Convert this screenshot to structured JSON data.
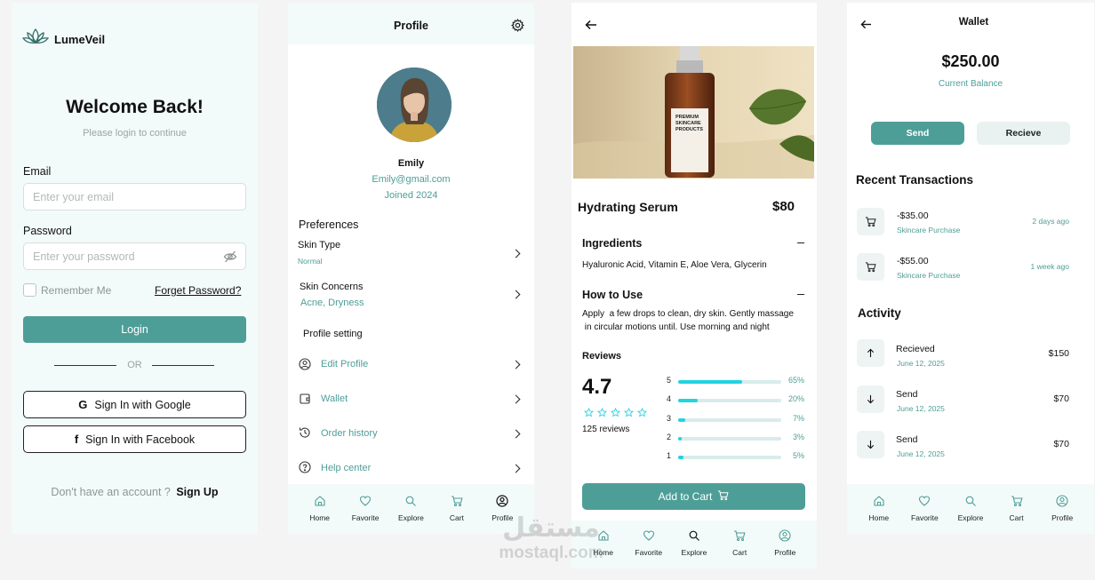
{
  "login": {
    "brand": "LumeVeil",
    "title": "Welcome Back!",
    "subtitle": "Please login to continue",
    "email_label": "Email",
    "email_placeholder": "Enter your email",
    "password_label": "Password",
    "password_placeholder": "Enter your password",
    "remember": "Remember Me",
    "forgot": "Forget Password?",
    "login_button": "Login",
    "or": "OR",
    "google": "Sign In with Google",
    "facebook": "Sign In with Facebook",
    "no_account": "Don't have an account ?",
    "signup": "Sign Up"
  },
  "profile": {
    "header": "Profile",
    "name": "Emily",
    "email": "Emily@gmail.com",
    "joined": "Joined 2024",
    "preferences": "Preferences",
    "skin_type_label": "Skin Type",
    "skin_type_value": "Normal",
    "skin_concerns_label": "Skin Concerns",
    "skin_concerns_value": "Acne, Dryness",
    "profile_setting": "Profile setting",
    "menu": [
      "Edit Profile",
      "Wallet",
      "Order history",
      "Help center"
    ]
  },
  "product": {
    "name": "Hydrating Serum",
    "price": "$80",
    "bottle_label": [
      "PREMIUM",
      "SKINCARE",
      "PRODUCTS"
    ],
    "ingredients_title": "Ingredients",
    "ingredients": "Hyaluronic Acid, Vitamin E, Aloe Vera, Glycerin",
    "how_title": "How to Use",
    "how_line1": "Apply  a few drops to clean, dry skin. Gently massage",
    "how_line2": " in circular motions until. Use morning and night",
    "reviews_title": "Reviews",
    "rating": "4.7",
    "review_count": "125 reviews",
    "rating_bars": [
      {
        "star": "5",
        "pct_label": "65%",
        "pct": 0.65
      },
      {
        "star": "4",
        "pct_label": "20%",
        "pct": 0.2
      },
      {
        "star": "3",
        "pct_label": "7%",
        "pct": 0.07
      },
      {
        "star": "2",
        "pct_label": "3%",
        "pct": 0.03
      },
      {
        "star": "1",
        "pct_label": "5%",
        "pct": 0.05
      }
    ],
    "add_to_cart": "Add to Cart"
  },
  "wallet": {
    "header": "Wallet",
    "balance": "$250.00",
    "balance_label": "Current Balance",
    "send": "Send",
    "receive": "Recieve",
    "recent_title": "Recent Transactions",
    "transactions": [
      {
        "amount": "-$35.00",
        "desc": "Skincare Purchase",
        "time": "2 days ago"
      },
      {
        "amount": "-$55.00",
        "desc": "Skincare Purchase",
        "time": "1 week ago"
      }
    ],
    "activity_title": "Activity",
    "activity": [
      {
        "type": "Recieved",
        "date": "June 12, 2025",
        "amount": "$150"
      },
      {
        "type": "Send",
        "date": "June 12, 2025",
        "amount": "$70"
      },
      {
        "type": "Send",
        "date": "June 12, 2025",
        "amount": "$70"
      }
    ]
  },
  "nav": {
    "home": "Home",
    "favorite": "Favorite",
    "explore": "Explore",
    "cart": "Cart",
    "profile": "Profile"
  },
  "watermark": {
    "arabic": "مستقل",
    "latin": "mostaql.com"
  },
  "colors": {
    "accent": "#4e9e98",
    "bar_fill": "#22d3e0",
    "panel_bg": "#f3fbfa"
  }
}
